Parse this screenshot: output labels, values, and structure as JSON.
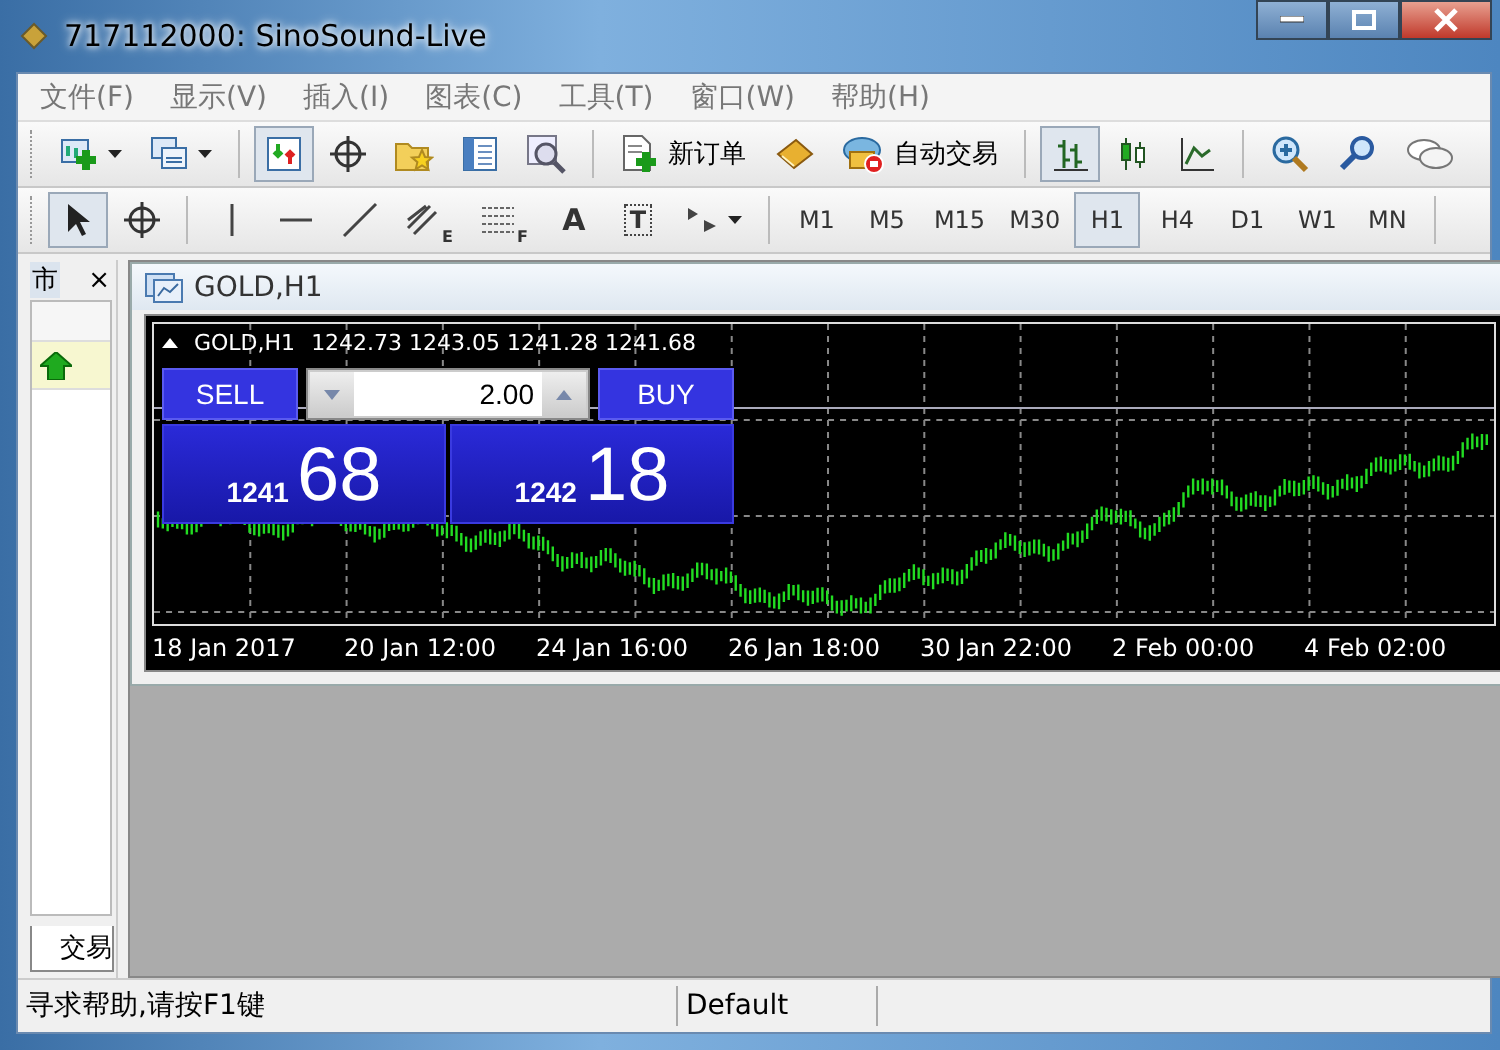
{
  "window": {
    "title": "717112000: SinoSound-Live"
  },
  "menu": [
    "文件(F)",
    "显示(V)",
    "插入(I)",
    "图表(C)",
    "工具(T)",
    "窗口(W)",
    "帮助(H)"
  ],
  "toolbar": [
    {
      "kind": "new-chart",
      "selected": false
    },
    {
      "kind": "profiles",
      "selected": false
    },
    {
      "kind": "sep"
    },
    {
      "kind": "market-watch",
      "selected": true
    },
    {
      "kind": "crosshair",
      "selected": false
    },
    {
      "kind": "favorites",
      "selected": false
    },
    {
      "kind": "navigator",
      "selected": false
    },
    {
      "kind": "tester",
      "selected": false
    },
    {
      "kind": "sep"
    },
    {
      "kind": "new-order",
      "label": "新订单"
    },
    {
      "kind": "editor",
      "selected": false
    },
    {
      "kind": "auto-trading",
      "label": "自动交易"
    },
    {
      "kind": "sep"
    },
    {
      "kind": "bars",
      "selected": true
    },
    {
      "kind": "candles",
      "selected": false
    },
    {
      "kind": "line",
      "selected": false
    },
    {
      "kind": "sep"
    },
    {
      "kind": "zoom-in",
      "selected": false
    },
    {
      "kind": "zoom-out",
      "selected": false
    },
    {
      "kind": "chat",
      "selected": false
    }
  ],
  "draw_tools": [
    {
      "kind": "cursor",
      "selected": true
    },
    {
      "kind": "crosshair",
      "selected": false
    },
    {
      "kind": "sep"
    },
    {
      "kind": "vline",
      "selected": false
    },
    {
      "kind": "hline",
      "selected": false
    },
    {
      "kind": "trendline",
      "selected": false
    },
    {
      "kind": "channel",
      "glyph": "E",
      "selected": false
    },
    {
      "kind": "fibo",
      "glyph": "F",
      "selected": false
    },
    {
      "kind": "text",
      "glyph": "A",
      "selected": false
    },
    {
      "kind": "label",
      "glyph": "T",
      "selected": false
    },
    {
      "kind": "arrows",
      "selected": false
    }
  ],
  "timeframes": [
    {
      "label": "M1",
      "selected": false
    },
    {
      "label": "M5",
      "selected": false
    },
    {
      "label": "M15",
      "selected": false
    },
    {
      "label": "M30",
      "selected": false
    },
    {
      "label": "H1",
      "selected": true
    },
    {
      "label": "H4",
      "selected": false
    },
    {
      "label": "D1",
      "selected": false
    },
    {
      "label": "W1",
      "selected": false
    },
    {
      "label": "MN",
      "selected": false
    }
  ],
  "market_watch": {
    "title": "市",
    "close": "×",
    "tab": "交易"
  },
  "chart": {
    "title": "GOLD,H1",
    "symbol": "GOLD,H1",
    "ohlc": "1242.73 1243.05 1241.28 1241.68",
    "trade": {
      "sell": "SELL",
      "buy": "BUY",
      "volume": "2.00",
      "sell_big": "1241",
      "sell_small": "68",
      "buy_big": "1242",
      "buy_small": "18"
    },
    "time_labels": [
      "18 Jan 2017",
      "20 Jan 12:00",
      "24 Jan 16:00",
      "26 Jan 18:00",
      "30 Jan 22:00",
      "2 Feb 00:00",
      "4 Feb 02:00"
    ]
  },
  "status_bar": [
    "寻求帮助,请按F1键",
    "Default"
  ]
}
